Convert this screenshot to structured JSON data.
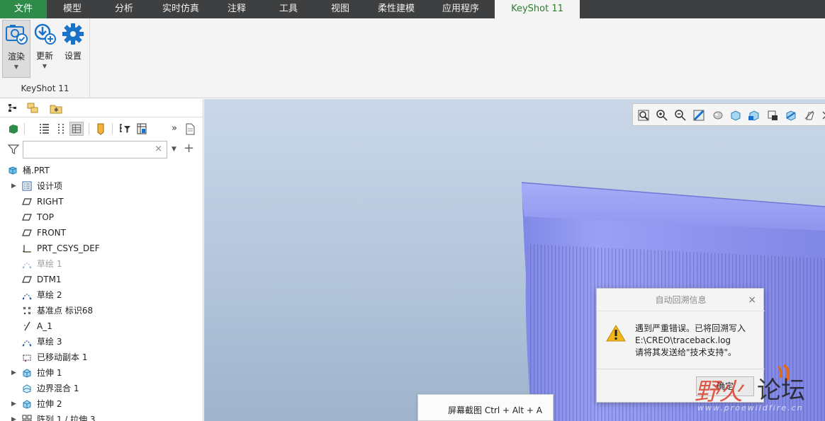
{
  "menubar": {
    "tabs": [
      "文件",
      "模型",
      "分析",
      "实时仿真",
      "注释",
      "工具",
      "视图",
      "柔性建模",
      "应用程序",
      "KeyShot 11"
    ],
    "active": "KeyShot 11"
  },
  "ribbon": {
    "buttons": [
      {
        "label": "渲染",
        "icon": "render-icon",
        "has_menu": true
      },
      {
        "label": "更新",
        "icon": "update-icon",
        "has_menu": true
      },
      {
        "label": "设置",
        "icon": "gear-icon",
        "has_menu": false
      }
    ],
    "group_label": "KeyShot 11"
  },
  "panel": {
    "search_placeholder": "",
    "clear_symbol": "×",
    "plus_symbol": "+",
    "more_symbol": "»"
  },
  "tree": {
    "root": "桶.PRT",
    "items": [
      {
        "label": "设计项",
        "icon": "design-items-icon",
        "expandable": true,
        "dim": false
      },
      {
        "label": "RIGHT",
        "icon": "datum-plane-icon",
        "expandable": false,
        "dim": false
      },
      {
        "label": "TOP",
        "icon": "datum-plane-icon",
        "expandable": false,
        "dim": false
      },
      {
        "label": "FRONT",
        "icon": "datum-plane-icon",
        "expandable": false,
        "dim": false
      },
      {
        "label": "PRT_CSYS_DEF",
        "icon": "csys-icon",
        "expandable": false,
        "dim": false
      },
      {
        "label": "草绘 1",
        "icon": "sketch-icon",
        "expandable": false,
        "dim": true
      },
      {
        "label": "DTM1",
        "icon": "datum-plane-icon",
        "expandable": false,
        "dim": false
      },
      {
        "label": "草绘 2",
        "icon": "sketch-icon",
        "expandable": false,
        "dim": false
      },
      {
        "label": "基准点 标识68",
        "icon": "datum-point-icon",
        "expandable": false,
        "dim": false
      },
      {
        "label": "A_1",
        "icon": "datum-axis-icon",
        "expandable": false,
        "dim": false
      },
      {
        "label": "草绘 3",
        "icon": "sketch-icon",
        "expandable": false,
        "dim": false
      },
      {
        "label": "已移动副本 1",
        "icon": "moved-copy-icon",
        "expandable": false,
        "dim": false
      },
      {
        "label": "拉伸 1",
        "icon": "extrude-icon",
        "expandable": true,
        "dim": false
      },
      {
        "label": "边界混合 1",
        "icon": "boundary-blend-icon",
        "expandable": false,
        "dim": false
      },
      {
        "label": "拉伸 2",
        "icon": "extrude-icon",
        "expandable": true,
        "dim": false
      },
      {
        "label": "阵列 1 / 拉伸 3",
        "icon": "pattern-icon",
        "expandable": true,
        "dim": false
      }
    ]
  },
  "tooltip": {
    "text": "屏幕截图 Ctrl + Alt + A"
  },
  "dialog": {
    "title": "自动回溯信息",
    "close": "×",
    "message_lines": [
      "遇到严重错误。已将回溯写入",
      "E:\\CREO\\traceback.log",
      "请将其发送给\"技术支持\"。"
    ],
    "ok_label": "确定"
  },
  "watermark": {
    "brand_a": "野火",
    "brand_b": "论坛",
    "url": "www.proewildfire.cn"
  },
  "colors": {
    "file_tab": "#2e8b4a",
    "menubar": "#3d3f41",
    "model": "#8f95ee",
    "accent_blue": "#1a73c9"
  }
}
